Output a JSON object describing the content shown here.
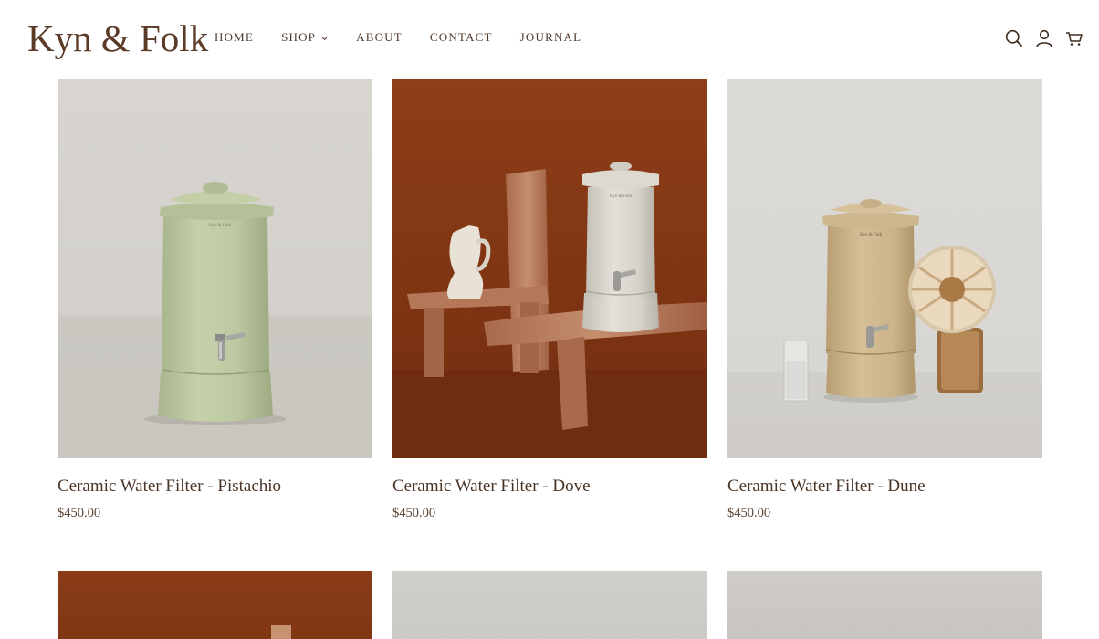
{
  "brand": {
    "logo": "Kyn & Folk"
  },
  "nav": {
    "home": "HOME",
    "shop": "SHOP",
    "about": "ABOUT",
    "contact": "CONTACT",
    "journal": "JOURNAL"
  },
  "header_icons": [
    "search-icon",
    "account-icon",
    "cart-icon"
  ],
  "colors": {
    "text": "#4a3426",
    "logo": "#5b3b28",
    "background": "#ffffff"
  },
  "products": [
    {
      "title": "Ceramic Water Filter - Pistachio",
      "price": "$450.00",
      "glaze": "#bac6a0",
      "backdrop": "light-grey"
    },
    {
      "title": "Ceramic Water Filter - Dove",
      "price": "$450.00",
      "glaze": "#d6d4cd",
      "backdrop": "rust"
    },
    {
      "title": "Ceramic Water Filter - Dune",
      "price": "$450.00",
      "glaze": "#ccb58c",
      "backdrop": "light-grey"
    }
  ]
}
